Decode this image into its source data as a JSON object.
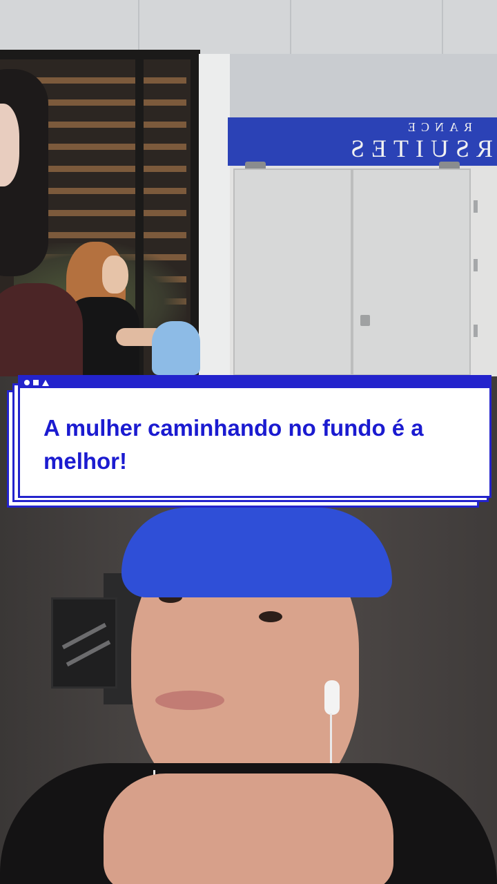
{
  "scene_top": {
    "sign": {
      "line1": "RANCE",
      "line2": "RSUITES"
    }
  },
  "caption": {
    "text": "A mulher caminhando no fundo é a melhor!",
    "titlebar_icons": [
      "circle-icon",
      "square-icon",
      "triangle-icon"
    ]
  },
  "colors": {
    "caption_accent": "#2323cc",
    "caption_text": "#1b1bd0",
    "cap": "#2f4fd7",
    "sign": "#2b42b6"
  }
}
